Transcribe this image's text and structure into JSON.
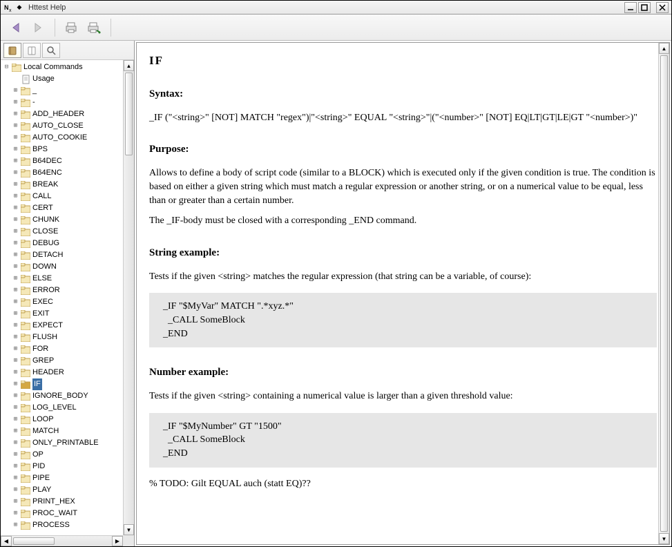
{
  "window": {
    "title": "Httest Help"
  },
  "toolbar": {
    "back": "Back",
    "forward": "Forward",
    "print": "Print",
    "print_preview": "Print Preview"
  },
  "sidebar_tabs": {
    "contents": "Contents",
    "index": "Index",
    "search": "Search"
  },
  "tree": {
    "root_label": "Local Commands",
    "root_expanded": true,
    "usage_label": "Usage",
    "selected": "IF",
    "items": [
      "_",
      "-",
      "ADD_HEADER",
      "AUTO_CLOSE",
      "AUTO_COOKIE",
      "BPS",
      "B64DEC",
      "B64ENC",
      "BREAK",
      "CALL",
      "CERT",
      "CHUNK",
      "CLOSE",
      "DEBUG",
      "DETACH",
      "DOWN",
      "ELSE",
      "ERROR",
      "EXEC",
      "EXIT",
      "EXPECT",
      "FLUSH",
      "FOR",
      "GREP",
      "HEADER",
      "IF",
      "IGNORE_BODY",
      "LOG_LEVEL",
      "LOOP",
      "MATCH",
      "ONLY_PRINTABLE",
      "OP",
      "PID",
      "PIPE",
      "PLAY",
      "PRINT_HEX",
      "PROC_WAIT",
      "PROCESS"
    ]
  },
  "doc": {
    "title": "IF",
    "syntax_h": "Syntax:",
    "syntax": "_IF (\"<string>\" [NOT] MATCH \"regex\")|\"<string>\" EQUAL \"<string>\"|(\"<number>\" [NOT] EQ|LT|GT|LE|GT \"<number>)\"",
    "purpose_h": "Purpose:",
    "purpose_p1": "Allows to define a body of script code (similar to a BLOCK) which is executed only if the given condition is true. The condition is based on either a given string which must match a regular expression or another string, or on a numerical value to be equal, less than or greater than a certain number.",
    "purpose_p2": "The _IF-body must be closed with a corresponding _END command.",
    "string_example_h": "String example:",
    "string_example_p": "Tests if the given <string> matches the regular expression (that string can be a variable, of course):",
    "string_example_code": "_IF \"$MyVar\" MATCH \".*xyz.*\"\n  _CALL SomeBlock\n_END",
    "number_example_h": "Number example:",
    "number_example_p": "Tests if the given <string> containing a numerical value is larger than a given threshold value:",
    "number_example_code": "_IF \"$MyNumber\" GT \"1500\"\n  _CALL SomeBlock\n_END",
    "todo": "% TODO: Gilt EQUAL auch (statt EQ)??"
  }
}
